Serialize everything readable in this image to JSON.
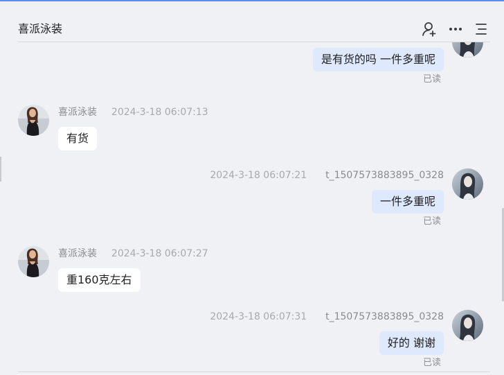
{
  "header": {
    "title": "喜派泳装",
    "icons": [
      "add-user-icon",
      "more-icon",
      "menu-icon"
    ]
  },
  "messages": [
    {
      "id": "m0",
      "side": "mine",
      "text": "是有货的吗 一件多重呢",
      "read": "已读"
    },
    {
      "id": "m1",
      "side": "theirs",
      "name": "喜派泳装",
      "time": "2024-3-18 06:07:13",
      "text": "有货"
    },
    {
      "id": "m2",
      "side": "mine",
      "name": "t_1507573883895_0328",
      "time": "2024-3-18 06:07:21",
      "text": "一件多重呢",
      "read": "已读"
    },
    {
      "id": "m3",
      "side": "theirs",
      "name": "喜派泳装",
      "time": "2024-3-18 06:07:27",
      "text": "重160克左右"
    },
    {
      "id": "m4",
      "side": "mine",
      "name": "t_1507573883895_0328",
      "time": "2024-3-18 06:07:31",
      "text": "好的 谢谢",
      "read": "已读"
    }
  ],
  "colors": {
    "accent": "#5b8def",
    "mine_bubble": "#dfe9fd",
    "theirs_bubble": "#ffffff",
    "background": "#f0f1f5"
  }
}
